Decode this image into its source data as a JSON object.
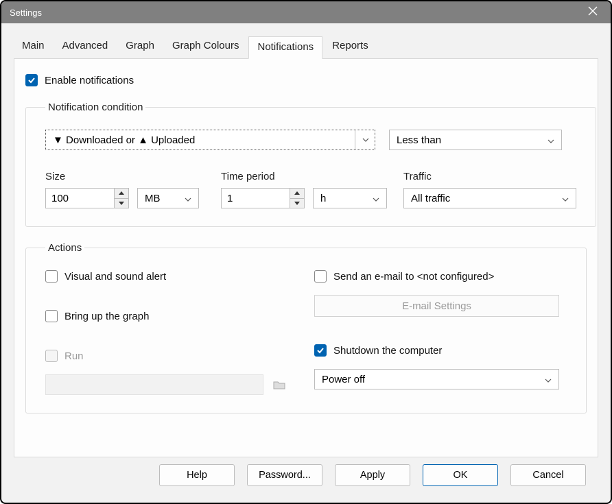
{
  "window": {
    "title": "Settings"
  },
  "tabs": [
    "Main",
    "Advanced",
    "Graph",
    "Graph Colours",
    "Notifications",
    "Reports"
  ],
  "activeTab": 4,
  "enableNotifications": {
    "label": "Enable notifications",
    "checked": true
  },
  "condition": {
    "legend": "Notification condition",
    "direction": "▼ Downloaded or ▲ Uploaded",
    "comparison": "Less than",
    "sizeLabel": "Size",
    "sizeValue": "100",
    "sizeUnit": "MB",
    "timeLabel": "Time period",
    "timeValue": "1",
    "timeUnit": "h",
    "trafficLabel": "Traffic",
    "trafficValue": "All traffic"
  },
  "actions": {
    "legend": "Actions",
    "visual": {
      "label": "Visual and sound alert",
      "checked": false
    },
    "graph": {
      "label": "Bring up the graph",
      "checked": false
    },
    "run": {
      "label": "Run",
      "checked": false,
      "disabled": true
    },
    "email": {
      "label": "Send an e-mail to <not configured>",
      "checked": false
    },
    "emailSettings": "E-mail Settings",
    "shutdown": {
      "label": "Shutdown the computer",
      "checked": true
    },
    "shutdownMode": "Power off"
  },
  "buttons": {
    "help": "Help",
    "password": "Password...",
    "apply": "Apply",
    "ok": "OK",
    "cancel": "Cancel"
  }
}
